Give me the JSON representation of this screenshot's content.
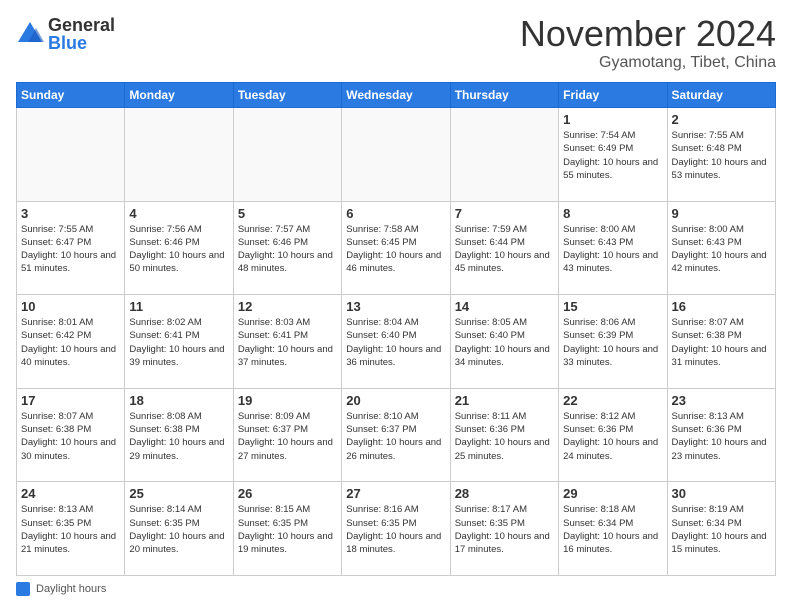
{
  "logo": {
    "general": "General",
    "blue": "Blue"
  },
  "title": "November 2024",
  "location": "Gyamotang, Tibet, China",
  "days_of_week": [
    "Sunday",
    "Monday",
    "Tuesday",
    "Wednesday",
    "Thursday",
    "Friday",
    "Saturday"
  ],
  "legend_label": "Daylight hours",
  "weeks": [
    [
      {
        "day": "",
        "info": ""
      },
      {
        "day": "",
        "info": ""
      },
      {
        "day": "",
        "info": ""
      },
      {
        "day": "",
        "info": ""
      },
      {
        "day": "",
        "info": ""
      },
      {
        "day": "1",
        "info": "Sunrise: 7:54 AM\nSunset: 6:49 PM\nDaylight: 10 hours and 55 minutes."
      },
      {
        "day": "2",
        "info": "Sunrise: 7:55 AM\nSunset: 6:48 PM\nDaylight: 10 hours and 53 minutes."
      }
    ],
    [
      {
        "day": "3",
        "info": "Sunrise: 7:55 AM\nSunset: 6:47 PM\nDaylight: 10 hours and 51 minutes."
      },
      {
        "day": "4",
        "info": "Sunrise: 7:56 AM\nSunset: 6:46 PM\nDaylight: 10 hours and 50 minutes."
      },
      {
        "day": "5",
        "info": "Sunrise: 7:57 AM\nSunset: 6:46 PM\nDaylight: 10 hours and 48 minutes."
      },
      {
        "day": "6",
        "info": "Sunrise: 7:58 AM\nSunset: 6:45 PM\nDaylight: 10 hours and 46 minutes."
      },
      {
        "day": "7",
        "info": "Sunrise: 7:59 AM\nSunset: 6:44 PM\nDaylight: 10 hours and 45 minutes."
      },
      {
        "day": "8",
        "info": "Sunrise: 8:00 AM\nSunset: 6:43 PM\nDaylight: 10 hours and 43 minutes."
      },
      {
        "day": "9",
        "info": "Sunrise: 8:00 AM\nSunset: 6:43 PM\nDaylight: 10 hours and 42 minutes."
      }
    ],
    [
      {
        "day": "10",
        "info": "Sunrise: 8:01 AM\nSunset: 6:42 PM\nDaylight: 10 hours and 40 minutes."
      },
      {
        "day": "11",
        "info": "Sunrise: 8:02 AM\nSunset: 6:41 PM\nDaylight: 10 hours and 39 minutes."
      },
      {
        "day": "12",
        "info": "Sunrise: 8:03 AM\nSunset: 6:41 PM\nDaylight: 10 hours and 37 minutes."
      },
      {
        "day": "13",
        "info": "Sunrise: 8:04 AM\nSunset: 6:40 PM\nDaylight: 10 hours and 36 minutes."
      },
      {
        "day": "14",
        "info": "Sunrise: 8:05 AM\nSunset: 6:40 PM\nDaylight: 10 hours and 34 minutes."
      },
      {
        "day": "15",
        "info": "Sunrise: 8:06 AM\nSunset: 6:39 PM\nDaylight: 10 hours and 33 minutes."
      },
      {
        "day": "16",
        "info": "Sunrise: 8:07 AM\nSunset: 6:38 PM\nDaylight: 10 hours and 31 minutes."
      }
    ],
    [
      {
        "day": "17",
        "info": "Sunrise: 8:07 AM\nSunset: 6:38 PM\nDaylight: 10 hours and 30 minutes."
      },
      {
        "day": "18",
        "info": "Sunrise: 8:08 AM\nSunset: 6:38 PM\nDaylight: 10 hours and 29 minutes."
      },
      {
        "day": "19",
        "info": "Sunrise: 8:09 AM\nSunset: 6:37 PM\nDaylight: 10 hours and 27 minutes."
      },
      {
        "day": "20",
        "info": "Sunrise: 8:10 AM\nSunset: 6:37 PM\nDaylight: 10 hours and 26 minutes."
      },
      {
        "day": "21",
        "info": "Sunrise: 8:11 AM\nSunset: 6:36 PM\nDaylight: 10 hours and 25 minutes."
      },
      {
        "day": "22",
        "info": "Sunrise: 8:12 AM\nSunset: 6:36 PM\nDaylight: 10 hours and 24 minutes."
      },
      {
        "day": "23",
        "info": "Sunrise: 8:13 AM\nSunset: 6:36 PM\nDaylight: 10 hours and 23 minutes."
      }
    ],
    [
      {
        "day": "24",
        "info": "Sunrise: 8:13 AM\nSunset: 6:35 PM\nDaylight: 10 hours and 21 minutes."
      },
      {
        "day": "25",
        "info": "Sunrise: 8:14 AM\nSunset: 6:35 PM\nDaylight: 10 hours and 20 minutes."
      },
      {
        "day": "26",
        "info": "Sunrise: 8:15 AM\nSunset: 6:35 PM\nDaylight: 10 hours and 19 minutes."
      },
      {
        "day": "27",
        "info": "Sunrise: 8:16 AM\nSunset: 6:35 PM\nDaylight: 10 hours and 18 minutes."
      },
      {
        "day": "28",
        "info": "Sunrise: 8:17 AM\nSunset: 6:35 PM\nDaylight: 10 hours and 17 minutes."
      },
      {
        "day": "29",
        "info": "Sunrise: 8:18 AM\nSunset: 6:34 PM\nDaylight: 10 hours and 16 minutes."
      },
      {
        "day": "30",
        "info": "Sunrise: 8:19 AM\nSunset: 6:34 PM\nDaylight: 10 hours and 15 minutes."
      }
    ]
  ]
}
